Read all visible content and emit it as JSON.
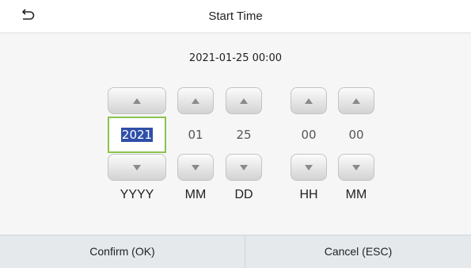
{
  "header": {
    "title": "Start Time",
    "back_icon": "back-arrow-icon"
  },
  "preview": {
    "datetime": "2021-01-25 00:00"
  },
  "fields": [
    {
      "key": "year",
      "label": "YYYY",
      "value": "2021",
      "selected": true
    },
    {
      "key": "month",
      "label": "MM",
      "value": "01"
    },
    {
      "key": "day",
      "label": "DD",
      "value": "25"
    },
    {
      "key": "hour",
      "label": "HH",
      "value": "00"
    },
    {
      "key": "minute",
      "label": "MM",
      "value": "00"
    }
  ],
  "footer": {
    "confirm_label": "Confirm (OK)",
    "cancel_label": "Cancel (ESC)"
  },
  "colors": {
    "focus_border": "#8bc34a",
    "selection": "#2f4fa8",
    "footer_bg": "#e5e9ec"
  }
}
